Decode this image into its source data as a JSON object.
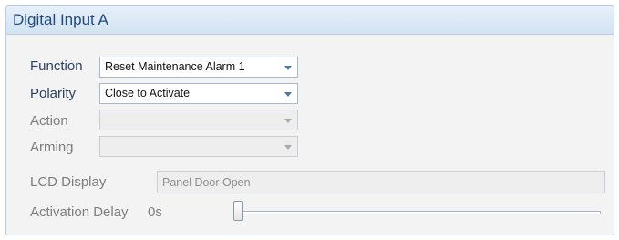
{
  "panel": {
    "title": "Digital Input A"
  },
  "fields": {
    "function": {
      "label": "Function",
      "value": "Reset Maintenance Alarm 1",
      "enabled": true
    },
    "polarity": {
      "label": "Polarity",
      "value": "Close to Activate",
      "enabled": true
    },
    "action": {
      "label": "Action",
      "value": "",
      "enabled": false
    },
    "arming": {
      "label": "Arming",
      "value": "",
      "enabled": false
    },
    "lcd_display": {
      "label": "LCD Display",
      "value": "Panel Door Open",
      "enabled": false
    },
    "activation_delay": {
      "label": "Activation Delay",
      "value": "0s",
      "slider_fraction": 0
    }
  },
  "icons": {
    "dropdown": "chevron-down-icon"
  },
  "colors": {
    "header_bg": "#dce8f5",
    "title_text": "#1f4b82",
    "active_label": "#2b3f63",
    "disabled_label": "#7d7d7d",
    "dropdown_arrow_active": "#4a78b0",
    "dropdown_arrow_disabled": "#a8a8a8"
  }
}
